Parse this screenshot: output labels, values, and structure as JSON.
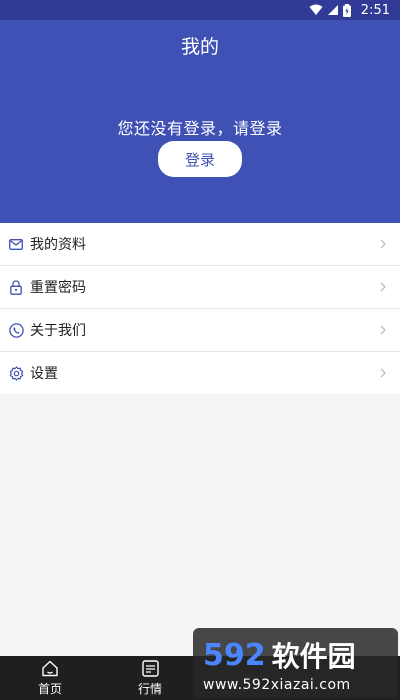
{
  "status_bar": {
    "time": "2:51"
  },
  "header": {
    "title": "我的",
    "login_prompt": "您还没有登录，请登录",
    "login_button": "登录",
    "background_color": "#3f51b5"
  },
  "menu": {
    "items": [
      {
        "label": "我的资料",
        "icon": "mail-icon"
      },
      {
        "label": "重置密码",
        "icon": "lock-icon"
      },
      {
        "label": "关于我们",
        "icon": "phone-icon"
      },
      {
        "label": "设置",
        "icon": "gear-icon"
      }
    ]
  },
  "bottom_nav": {
    "items": [
      {
        "label": "首页",
        "icon": "home-icon"
      },
      {
        "label": "行情",
        "icon": "chart-box-icon"
      }
    ]
  },
  "watermark": {
    "num": "592",
    "cn": "软件园",
    "url": "www.592xiazai.com"
  }
}
